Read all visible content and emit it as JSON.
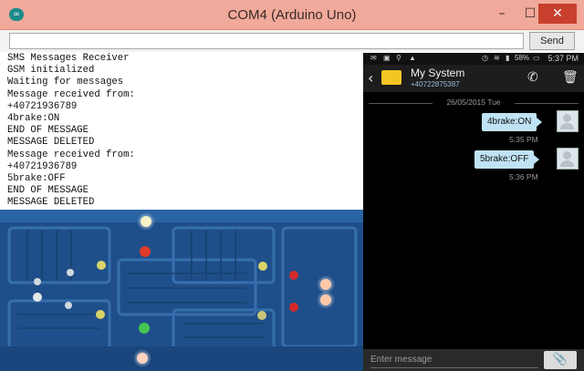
{
  "window": {
    "title": "COM4 (Arduino Uno)",
    "app_icon": "∞",
    "minimize": "–",
    "maximize": "☐",
    "close": "✕"
  },
  "serial": {
    "input_value": "",
    "send_label": "Send",
    "lines": [
      "SMS Messages Receiver",
      "GSM initialized",
      "Waiting for messages",
      "Message received from:",
      "+40721936789",
      "4brake:ON",
      "END OF MESSAGE",
      "MESSAGE DELETED",
      "Message received from:",
      "+40721936789",
      "5brake:OFF",
      "END OF MESSAGE",
      "MESSAGE DELETED"
    ]
  },
  "board_leds": [
    {
      "color": "white",
      "lit": true
    },
    {
      "color": "red",
      "lit": true
    },
    {
      "color": "yellow",
      "lit": true
    },
    {
      "color": "white",
      "lit": false
    },
    {
      "color": "white",
      "lit": false
    },
    {
      "color": "white",
      "lit": false
    },
    {
      "color": "yellow",
      "lit": true
    },
    {
      "color": "red",
      "lit": false
    },
    {
      "color": "red",
      "lit": true
    },
    {
      "color": "yellow",
      "lit": true
    },
    {
      "color": "yellow",
      "lit": false
    },
    {
      "color": "green",
      "lit": true
    },
    {
      "color": "red",
      "lit": true
    },
    {
      "color": "red",
      "lit": false
    },
    {
      "color": "white",
      "lit": true
    },
    {
      "color": "white",
      "lit": true
    }
  ],
  "phone": {
    "status_time": "5:37 PM",
    "status_battery": "58%",
    "contact_name": "My System",
    "contact_number": "+40722875387",
    "date": "26/05/2015 Tue",
    "messages": [
      {
        "text": "4brake:ON",
        "time": "5:35 PM"
      },
      {
        "text": "5brake:OFF",
        "time": "5:36 PM"
      }
    ],
    "compose_placeholder": "Enter message",
    "icons": {
      "back": "‹",
      "call": "✆",
      "trash": "🗑",
      "attach": "📎"
    }
  },
  "colors": {
    "titlebar": "#f0a99a",
    "close_button": "#c8402d",
    "board": "#1f4f8a",
    "bubble": "#bfe3f5"
  }
}
